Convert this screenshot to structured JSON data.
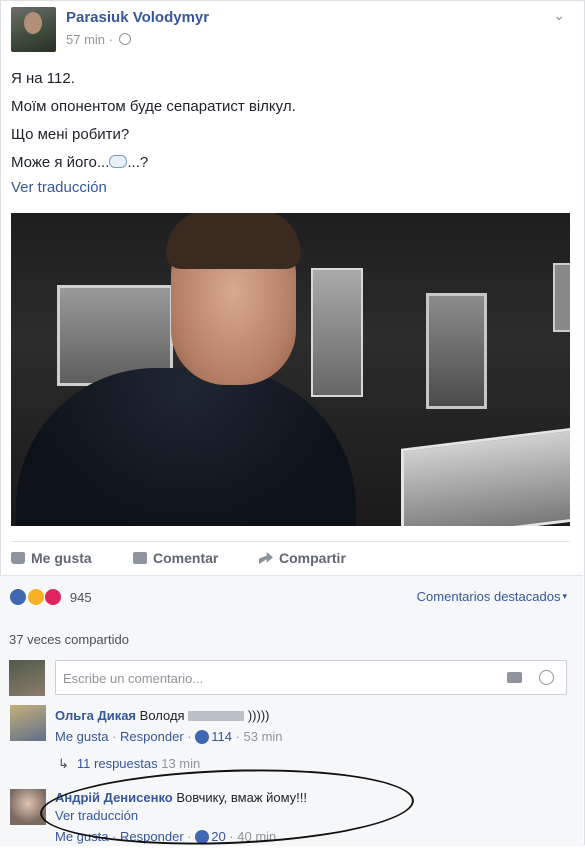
{
  "post": {
    "author": "Parasiuk Volodymyr",
    "time": "57 min",
    "separator": "·",
    "lines": [
      "Я на 112.",
      "Моїм опонентом буде сепаратист вілкул.",
      "Що мені робити?",
      "Може я його..."
    ],
    "line4_suffix": "...?",
    "see_translation": "Ver traducción",
    "photo_alt": "photo",
    "emoji_icon": "speech-bubble-icon"
  },
  "actions": {
    "like": "Me gusta",
    "comment": "Comentar",
    "share": "Compartir"
  },
  "reactions": {
    "count": "945",
    "top_comments": "Comentarios destacados",
    "caret": "▾"
  },
  "shares": "37 veces compartido",
  "composer": {
    "placeholder": "Escribe un comentario..."
  },
  "comments": [
    {
      "name": "Ольга Дикая",
      "text_before": "Володя",
      "text_after": ")))))",
      "like": "Me gusta",
      "reply": "Responder",
      "reactions": "114",
      "time": "53 min"
    },
    {
      "name": "Андрій Денисенко",
      "text": "Вовчику, вмаж йому!!!",
      "translate": "Ver traducción",
      "like": "Me gusta",
      "reply": "Responder",
      "reactions": "20",
      "time": "40 min"
    }
  ],
  "replies": {
    "label": "11 respuestas",
    "time": "13 min"
  },
  "colors": {
    "link": "#365899",
    "muted": "#90949c",
    "like_blue": "#4267b2",
    "love_red": "#e0245e",
    "haha_yellow": "#f7b125"
  }
}
